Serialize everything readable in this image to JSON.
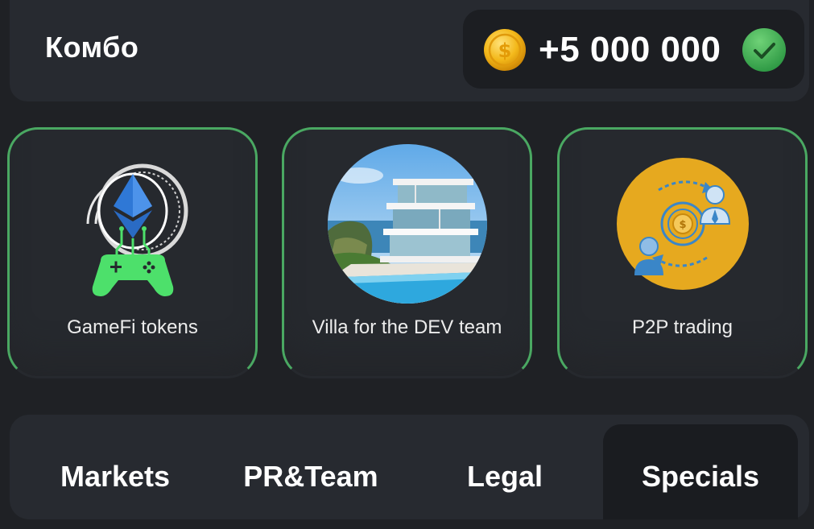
{
  "combo": {
    "title": "Комбо",
    "reward_amount": "+5 000 000",
    "coin_icon": "coin-icon",
    "check_icon": "check-circle-icon",
    "colors": {
      "coin": "#f3b81a",
      "check": "#3fae52",
      "card_border": "#4aa862"
    }
  },
  "cards": [
    {
      "label": "GameFi tokens",
      "icon": "gamepad-ethereum-icon"
    },
    {
      "label": "Villa for the DEV team",
      "icon": "villa-image"
    },
    {
      "label": "P2P trading",
      "icon": "p2p-exchange-icon"
    }
  ],
  "tabs": [
    {
      "label": "Markets",
      "active": false
    },
    {
      "label": "PR&Team",
      "active": false
    },
    {
      "label": "Legal",
      "active": false
    },
    {
      "label": "Specials",
      "active": true
    }
  ]
}
